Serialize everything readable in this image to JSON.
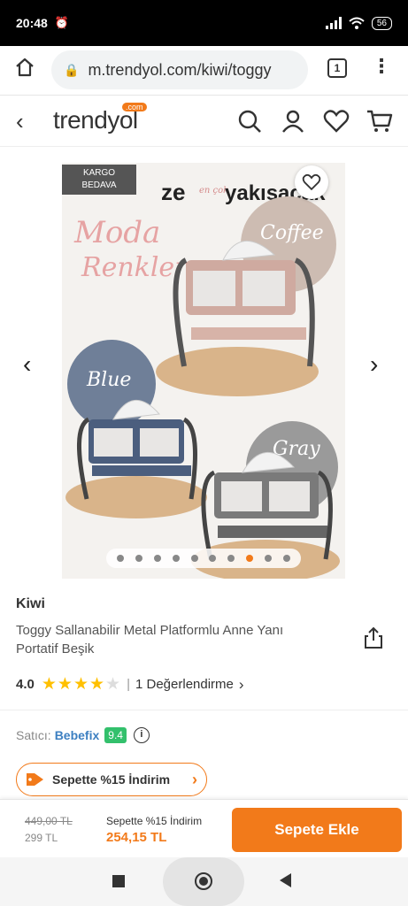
{
  "status_bar": {
    "time": "20:48",
    "battery": "56"
  },
  "browser": {
    "url": "m.trendyol.com/kiwi/toggy",
    "tab_count": "1"
  },
  "site": {
    "logo": "trendyol",
    "logo_badge": ".com"
  },
  "gallery": {
    "cargo_badge_line1": "KARGO",
    "cargo_badge_line2": "BEDAVA",
    "banner_text": "ze",
    "banner_small": "en çok",
    "banner_big": "yakışacak",
    "script_title_1": "Moda",
    "script_title_2": "Renkler",
    "colors": {
      "coffee": "Coffee",
      "blue": "Blue",
      "gray": "Gray"
    },
    "dot_count": 10,
    "active_dot": 8
  },
  "product": {
    "brand": "Kiwi",
    "name": "Toggy Sallanabilir Metal Platformlu Anne Yanı Portatif Beşik",
    "rating": "4.0",
    "stars": 4,
    "review_label": "1 Değerlendirme"
  },
  "seller": {
    "label": "Satıcı:",
    "name": "Bebefix",
    "score": "9.4"
  },
  "promo": {
    "label": "Sepette %15 İndirim"
  },
  "bottom_bar": {
    "old_price": "449,00 TL",
    "mid_price": "299 TL",
    "promo_label": "Sepette %15 İndirim",
    "final_price": "254,15 TL",
    "add_button": "Sepete Ekle"
  },
  "colors": {
    "accent": "#f27a1a",
    "seller_score": "#33c06c",
    "seller_link": "#3c7fc1"
  }
}
